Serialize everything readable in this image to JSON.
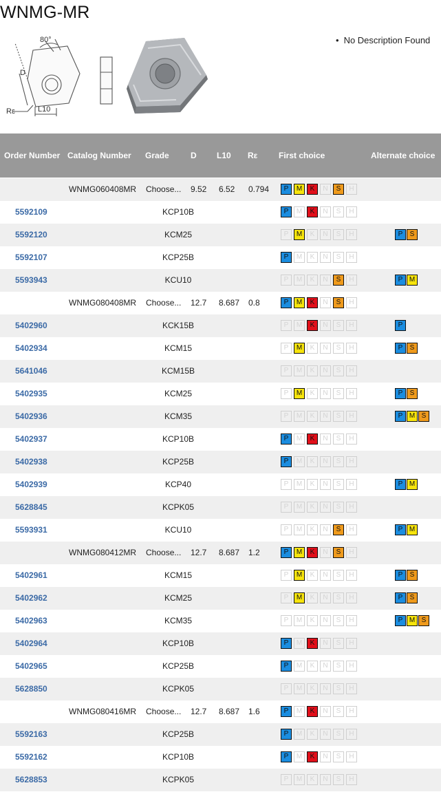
{
  "page": {
    "title": "WNMG-MR",
    "description": "No Description Found"
  },
  "drawing": {
    "angle_label": "80°",
    "d_label": "D",
    "re_label": "Rε",
    "l10_label": "L10"
  },
  "columns": {
    "order_number": "Order Number",
    "catalog_number": "Catalog Number",
    "grade": "Grade",
    "d": "D",
    "l10": "L10",
    "re": "Rε",
    "first_choice": "First choice",
    "alternate_choice": "Alternate choice"
  },
  "materials": [
    "P",
    "M",
    "K",
    "N",
    "S",
    "H"
  ],
  "colors": {
    "P": "#1b8de0",
    "M": "#f7e40c",
    "K": "#e10f1a",
    "S": "#ef9a1c",
    "header": "#999999",
    "link": "#3b6aa6"
  },
  "rows": [
    {
      "type": "parent",
      "catalog": "WNMG060408MR",
      "grade": "Choose...",
      "d": "9.52",
      "l10": "6.52",
      "re": "0.794",
      "first": [
        "P",
        "M",
        "K",
        "S"
      ],
      "alt": []
    },
    {
      "type": "child",
      "order": "5592109",
      "grade": "KCP10B",
      "first": [
        "P",
        "K"
      ],
      "alt": []
    },
    {
      "type": "child",
      "order": "5592120",
      "grade": "KCM25",
      "first": [
        "M"
      ],
      "alt": [
        "P",
        "S"
      ]
    },
    {
      "type": "child",
      "order": "5592107",
      "grade": "KCP25B",
      "first": [
        "P"
      ],
      "alt": []
    },
    {
      "type": "child",
      "order": "5593943",
      "grade": "KCU10",
      "first": [
        "S"
      ],
      "alt": [
        "P",
        "M"
      ]
    },
    {
      "type": "parent",
      "catalog": "WNMG080408MR",
      "grade": "Choose...",
      "d": "12.7",
      "l10": "8.687",
      "re": "0.8",
      "first": [
        "P",
        "M",
        "K",
        "S"
      ],
      "alt": []
    },
    {
      "type": "child",
      "order": "5402960",
      "grade": "KCK15B",
      "first": [
        "K"
      ],
      "alt": [
        "P"
      ]
    },
    {
      "type": "child",
      "order": "5402934",
      "grade": "KCM15",
      "first": [
        "M"
      ],
      "alt": [
        "P",
        "S"
      ]
    },
    {
      "type": "child",
      "order": "5641046",
      "grade": "KCM15B",
      "first": [],
      "alt": []
    },
    {
      "type": "child",
      "order": "5402935",
      "grade": "KCM25",
      "first": [
        "M"
      ],
      "alt": [
        "P",
        "S"
      ]
    },
    {
      "type": "child",
      "order": "5402936",
      "grade": "KCM35",
      "first": [],
      "alt": [
        "P",
        "M",
        "S"
      ]
    },
    {
      "type": "child",
      "order": "5402937",
      "grade": "KCP10B",
      "first": [
        "P",
        "K"
      ],
      "alt": []
    },
    {
      "type": "child",
      "order": "5402938",
      "grade": "KCP25B",
      "first": [
        "P"
      ],
      "alt": []
    },
    {
      "type": "child",
      "order": "5402939",
      "grade": "KCP40",
      "first": [],
      "alt": [
        "P",
        "M"
      ]
    },
    {
      "type": "child",
      "order": "5628845",
      "grade": "KCPK05",
      "first": [],
      "alt": []
    },
    {
      "type": "child",
      "order": "5593931",
      "grade": "KCU10",
      "first": [
        "S"
      ],
      "alt": [
        "P",
        "M"
      ]
    },
    {
      "type": "parent",
      "catalog": "WNMG080412MR",
      "grade": "Choose...",
      "d": "12.7",
      "l10": "8.687",
      "re": "1.2",
      "first": [
        "P",
        "M",
        "K",
        "S"
      ],
      "alt": []
    },
    {
      "type": "child",
      "order": "5402961",
      "grade": "KCM15",
      "first": [
        "M"
      ],
      "alt": [
        "P",
        "S"
      ]
    },
    {
      "type": "child",
      "order": "5402962",
      "grade": "KCM25",
      "first": [
        "M"
      ],
      "alt": [
        "P",
        "S"
      ]
    },
    {
      "type": "child",
      "order": "5402963",
      "grade": "KCM35",
      "first": [],
      "alt": [
        "P",
        "M",
        "S"
      ]
    },
    {
      "type": "child",
      "order": "5402964",
      "grade": "KCP10B",
      "first": [
        "P",
        "K"
      ],
      "alt": []
    },
    {
      "type": "child",
      "order": "5402965",
      "grade": "KCP25B",
      "first": [
        "P"
      ],
      "alt": []
    },
    {
      "type": "child",
      "order": "5628850",
      "grade": "KCPK05",
      "first": [],
      "alt": []
    },
    {
      "type": "parent",
      "catalog": "WNMG080416MR",
      "grade": "Choose...",
      "d": "12.7",
      "l10": "8.687",
      "re": "1.6",
      "first": [
        "P",
        "K"
      ],
      "alt": []
    },
    {
      "type": "child",
      "order": "5592163",
      "grade": "KCP25B",
      "first": [
        "P"
      ],
      "alt": []
    },
    {
      "type": "child",
      "order": "5592162",
      "grade": "KCP10B",
      "first": [
        "P",
        "K"
      ],
      "alt": []
    },
    {
      "type": "child",
      "order": "5628853",
      "grade": "KCPK05",
      "first": [],
      "alt": []
    }
  ]
}
